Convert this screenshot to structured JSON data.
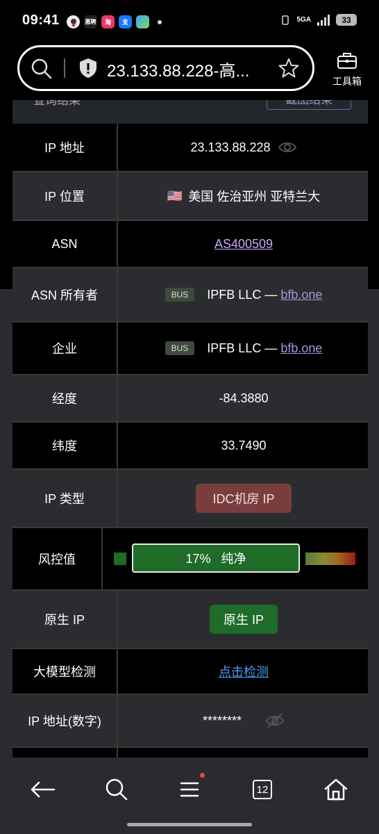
{
  "status_bar": {
    "time": "09:41",
    "network": "5GA",
    "battery": "33",
    "app_icons": [
      {
        "name": "qq-icon",
        "color": "#e9e9e9",
        "text": ""
      },
      {
        "name": "app-icon-2",
        "color": "#333",
        "text": "惠聘"
      },
      {
        "name": "taobao-icon",
        "color": "#e8366b",
        "text": "淘"
      },
      {
        "name": "alipay-icon",
        "color": "#1677ff",
        "text": "支"
      },
      {
        "name": "app-icon-5",
        "color": "#3fa9f5",
        "text": ""
      }
    ]
  },
  "browser": {
    "url": "23.133.88.228-高...",
    "toolbox_label": "工具箱",
    "tab_count": "12"
  },
  "partial_header": {
    "left_text": "查询结果",
    "right_button": "截图结果"
  },
  "rows": [
    {
      "label": "IP 地址",
      "value": "23.133.88.228"
    },
    {
      "label": "IP 位置",
      "flag": "🇺🇸",
      "value": "美国 佐治亚州 亚特兰大"
    },
    {
      "label": "ASN",
      "value": "AS400509"
    },
    {
      "label": "ASN 所有者",
      "badge": "BUS",
      "value": "IPFB LLC — ",
      "link": "bfb.one"
    },
    {
      "label": "企业",
      "badge": "BUS",
      "value": "IPFB LLC — ",
      "link": "bfb.one"
    },
    {
      "label": "经度",
      "value": "-84.3880"
    },
    {
      "label": "纬度",
      "value": "33.7490"
    },
    {
      "label": "IP 类型",
      "value": "IDC机房 IP"
    },
    {
      "label": "风控值",
      "value": "17%   纯净",
      "score_percent": 17
    },
    {
      "label": "原生 IP",
      "value": "原生 IP"
    },
    {
      "label": "大模型检测",
      "value": "点击检测"
    },
    {
      "label": "IP 地址(数字)",
      "value": "********"
    }
  ],
  "colors": {
    "accent_purple": "#c7a8f2",
    "link_blue": "#4a9cf0",
    "idc_red": "#7a3d3d",
    "clean_green": "#1f6b28"
  }
}
